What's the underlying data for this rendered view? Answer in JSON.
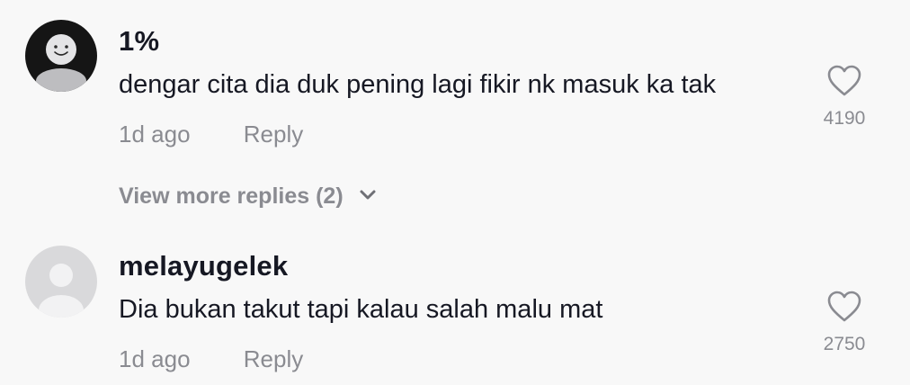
{
  "comments": [
    {
      "username": "1%",
      "text": "dengar cita dia duk pening lagi fikir nk masuk ka tak",
      "time": "1d ago",
      "reply_label": "Reply",
      "likes": "4190",
      "avatar_icon": "smiley-avatar-icon"
    },
    {
      "username": "melayugelek",
      "text": "Dia bukan takut tapi kalau salah malu mat",
      "time": "1d ago",
      "reply_label": "Reply",
      "likes": "2750",
      "avatar_icon": "default-user-avatar-icon"
    }
  ],
  "view_more": {
    "label": "View more replies (2)",
    "icon": "chevron-down-icon"
  },
  "colors": {
    "background": "#f8f8f8",
    "primary_text": "#161823",
    "secondary_text": "#8a8b91"
  }
}
